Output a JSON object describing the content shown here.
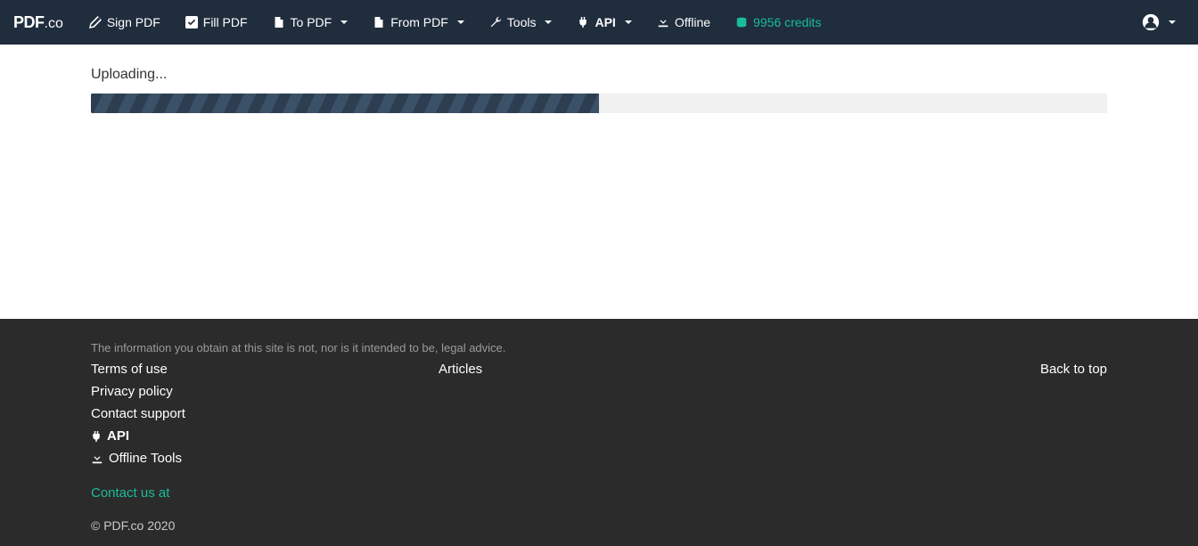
{
  "brand": {
    "pdf": "PDF",
    "co": ".co"
  },
  "nav": {
    "sign": "Sign PDF",
    "fill": "Fill PDF",
    "to": "To PDF",
    "from": "From PDF",
    "tools": "Tools",
    "api": "API",
    "offline": "Offline",
    "credits": "9956 credits"
  },
  "main": {
    "status": "Uploading...",
    "progress_percent": 50
  },
  "footer": {
    "disclaimer": "The information you obtain at this site is not, nor is it intended to be, legal advice.",
    "links": {
      "terms": "Terms of use",
      "privacy": "Privacy policy",
      "support": "Contact support",
      "api": "API",
      "offline": "Offline Tools",
      "articles": "Articles",
      "backtop": "Back to top"
    },
    "contact": "Contact us at",
    "copyright": "© PDF.co 2020"
  }
}
